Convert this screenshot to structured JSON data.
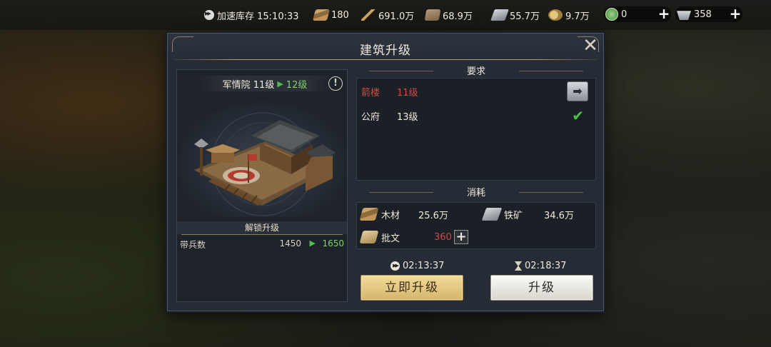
{
  "topbar": {
    "speed_stock": "加速库存 15:10:33",
    "wood": "180",
    "grain": "691.0万",
    "stone": "68.9万",
    "iron": "55.7万",
    "copper": "9.7万",
    "jade": "0",
    "ingot": "358"
  },
  "dialog": {
    "title": "建筑升级",
    "building": {
      "name": "军情院 11级",
      "next_level": "12级"
    },
    "unlock": {
      "heading": "解锁升级",
      "stat_label": "带兵数",
      "stat_from": "1450",
      "stat_to": "1650"
    },
    "requirements": {
      "heading": "要求",
      "items": [
        {
          "name": "箭楼",
          "level": "11级",
          "met": false
        },
        {
          "name": "公府",
          "level": "13级",
          "met": true
        }
      ]
    },
    "cost": {
      "heading": "消耗",
      "items": [
        {
          "name": "木材",
          "value": "25.6万",
          "icon": "wood-icon"
        },
        {
          "name": "铁矿",
          "value": "34.6万",
          "icon": "iron-icon"
        },
        {
          "name": "批文",
          "value": "360",
          "icon": "permit-icon"
        }
      ]
    },
    "instant": {
      "time": "02:13:37",
      "label": "立即升级"
    },
    "normal": {
      "time": "02:18:37",
      "label": "升级"
    }
  },
  "colors": {
    "accent_gold": "#d5b56b",
    "unmet_red": "#d24a40",
    "met_green": "#4fc04a"
  }
}
